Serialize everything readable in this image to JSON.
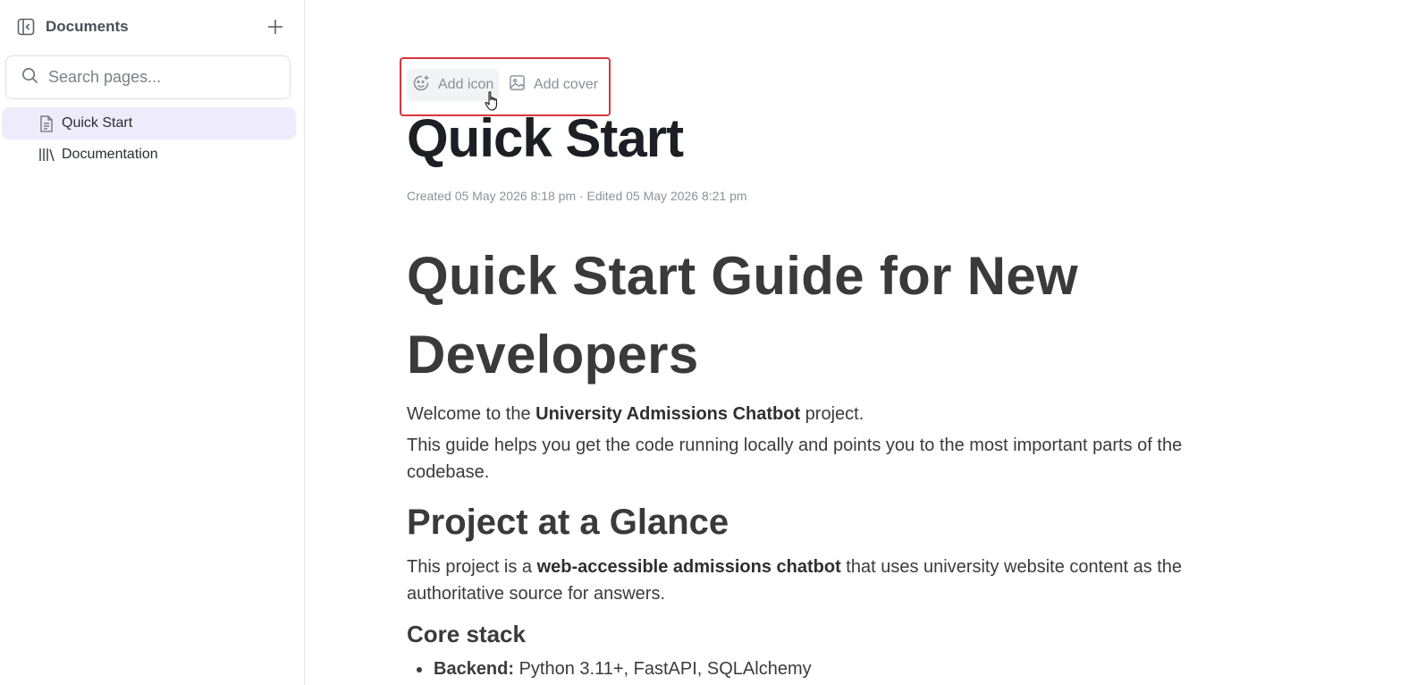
{
  "sidebar": {
    "title": "Documents",
    "search_placeholder": "Search pages...",
    "items": [
      {
        "label": "Quick Start",
        "icon": "document-icon",
        "active": true
      },
      {
        "label": "Documentation",
        "icon": "library-icon",
        "active": false
      }
    ]
  },
  "toolbar": {
    "add_icon_label": "Add icon",
    "add_cover_label": "Add cover"
  },
  "page": {
    "title": "Quick Start",
    "meta": "Created 05 May 2026 8:18 pm · Edited 05 May 2026 8:21 pm"
  },
  "content": {
    "heading1": "Quick Start Guide for New Developers",
    "intro": {
      "prefix": "Welcome to the ",
      "bold": "University Admissions Chatbot",
      "suffix": " project."
    },
    "guide": "This guide helps you get the code running locally and points you to the most important parts of the codebase.",
    "heading2": "Project at a Glance",
    "glance": {
      "prefix": "This project is a ",
      "bold": "web-accessible admissions chatbot",
      "suffix": " that uses university website content as the authoritative source for answers."
    },
    "heading3": "Core stack",
    "stack_items": [
      {
        "label": "Backend:",
        "value": " Python 3.11+, FastAPI, SQLAlchemy"
      }
    ]
  },
  "colors": {
    "accent_highlight": "#d9363e",
    "active_nav": "#eeebfb"
  }
}
